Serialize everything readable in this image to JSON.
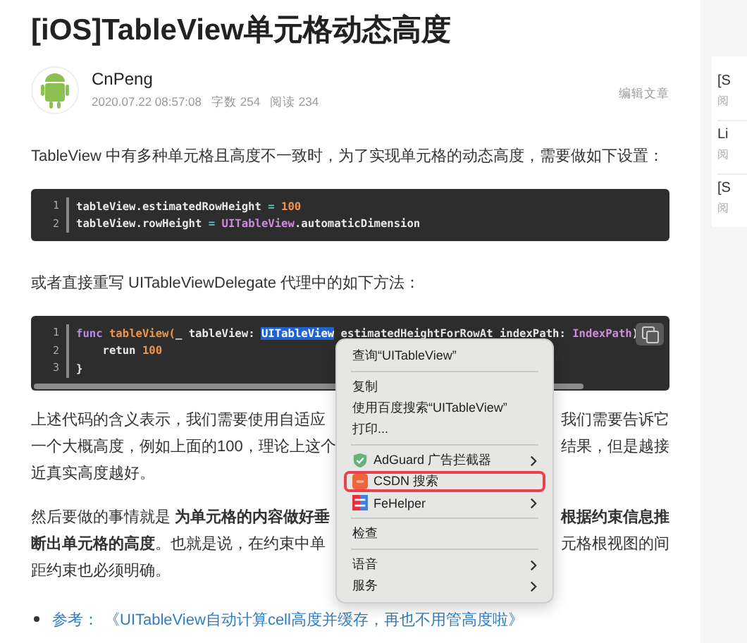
{
  "title": "[iOS]TableView单元格动态高度",
  "author": {
    "name": "CnPeng",
    "date": "2020.07.22 08:57:08",
    "words": "字数 254",
    "reads": "阅读 234",
    "edit": "编辑文章"
  },
  "intro": "TableView 中有多种单元格且高度不一致时，为了实现单元格的动态高度，需要做如下设置：",
  "code_1": {
    "lines": [
      {
        "number": "1",
        "tokens": [
          {
            "kind": "plain",
            "text": "tableView.estimatedRowHeight ",
            "selected": false
          },
          {
            "kind": "op",
            "text": "=",
            "selected": false
          },
          {
            "kind": "number",
            "text": " 100",
            "selected": false
          }
        ]
      },
      {
        "number": "2",
        "tokens": [
          {
            "kind": "plain",
            "text": "tableView.rowHeight ",
            "selected": false
          },
          {
            "kind": "op",
            "text": "=",
            "selected": false
          },
          {
            "kind": "type",
            "text": " UITableView",
            "selected": false
          },
          {
            "kind": "plain",
            "text": ".automaticDimension",
            "selected": false
          }
        ]
      }
    ]
  },
  "para_2": "或者直接重写 UITableViewDelegate 代理中的如下方法：",
  "code_2": {
    "lines": [
      {
        "number": "1",
        "tokens": [
          {
            "kind": "keyword",
            "text": "func ",
            "selected": false
          },
          {
            "kind": "func",
            "text": "tableView(",
            "selected": false
          },
          {
            "kind": "plain",
            "text": "_ tableView: ",
            "selected": false
          },
          {
            "kind": "type",
            "text": "UITableView",
            "selected": true
          },
          {
            "kind": "plain",
            "text": " estimatedHeightForRowAt indexPath: ",
            "selected": false
          },
          {
            "kind": "type",
            "text": "IndexPath",
            "selected": false
          },
          {
            "kind": "plain",
            "text": ")",
            "selected": false
          }
        ]
      },
      {
        "number": "2",
        "tokens": [
          {
            "kind": "plain",
            "text": "    retun ",
            "selected": false
          },
          {
            "kind": "number",
            "text": "100",
            "selected": false
          }
        ]
      },
      {
        "number": "3",
        "tokens": [
          {
            "kind": "plain",
            "text": "}",
            "selected": false
          }
        ]
      }
    ]
  },
  "para_3_lines": [
    {
      "left": "上述代码的含义表示，我们需要使用自适应",
      "right": "我们需要告诉它"
    },
    {
      "left": "一个大概高度，例如上面的100，理论上这个",
      "right": "结果，但是越接"
    },
    {
      "left": "近真实高度越好。"
    }
  ],
  "para_4_lines": [
    {
      "left": "然后要做的事情就是 **为单元格的内容做好垂**",
      "right": "**根据约束信息推**"
    },
    {
      "left": "**断出单元格的高度**。也就是说，在约束中单",
      "right": "元格根视图的间"
    },
    {
      "left": "距约束也必须明确。"
    }
  ],
  "reference": {
    "label": "参考：",
    "link": "《UITableView自动计算cell高度并缓存，再也不用管高度啦》"
  },
  "context_menu": {
    "items": [
      {
        "kind": "item",
        "label": "查询“UITableView”",
        "submenu": false,
        "highlighted": false
      },
      {
        "kind": "separator"
      },
      {
        "kind": "item",
        "label": "复制",
        "submenu": false,
        "highlighted": false
      },
      {
        "kind": "item",
        "label": "使用百度搜索“UITableView”",
        "submenu": false,
        "highlighted": false
      },
      {
        "kind": "item",
        "label": "打印...",
        "submenu": false,
        "highlighted": false
      },
      {
        "kind": "separator"
      },
      {
        "kind": "shield",
        "label": "AdGuard 广告拦截器",
        "submenu": true,
        "highlighted": false
      },
      {
        "kind": "csdn",
        "label": "CSDN 搜索",
        "submenu": false,
        "highlighted": true
      },
      {
        "kind": "fe",
        "label": "FeHelper",
        "submenu": true,
        "highlighted": false
      },
      {
        "kind": "separator"
      },
      {
        "kind": "item",
        "label": "检查",
        "submenu": false,
        "highlighted": false
      },
      {
        "kind": "separator"
      },
      {
        "kind": "item",
        "label": "语音",
        "submenu": true,
        "highlighted": false
      },
      {
        "kind": "item",
        "label": "服务",
        "submenu": true,
        "highlighted": false
      }
    ]
  },
  "sidebar": {
    "items": [
      {
        "title": "[S",
        "meta": "阅"
      },
      {
        "title": "Li",
        "meta": "阅"
      },
      {
        "title": "[S",
        "meta": "阅"
      }
    ]
  }
}
